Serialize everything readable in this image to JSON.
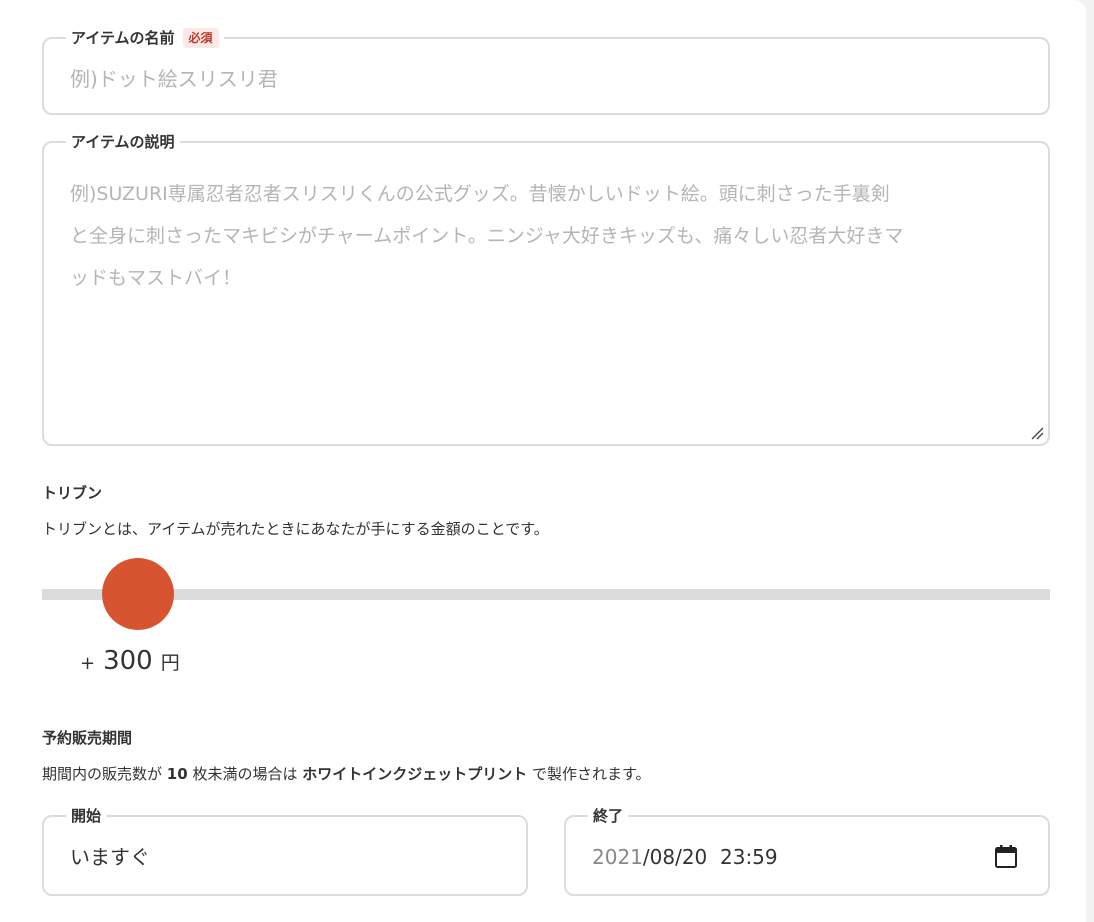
{
  "item_name": {
    "label": "アイテムの名前",
    "required_badge": "必須",
    "placeholder": "例)ドット絵スリスリ君"
  },
  "item_description": {
    "label": "アイテムの説明",
    "placeholder": "例)SUZURI専属忍者忍者スリスリくんの公式グッズ。昔懐かしいドット絵。頭に刺さった手裏剣\nと全身に刺さったマキビシがチャームポイント。ニンジャ大好きキッズも、痛々しい忍者大好きマ\nッドもマストバイ！"
  },
  "triben": {
    "title": "トリブン",
    "description": "トリブンとは、アイテムが売れたときにあなたが手にする金額のことです。",
    "plus": "+",
    "amount": "300",
    "unit": "円",
    "slider_fraction": 0.06
  },
  "presale": {
    "title": "予約販売期間",
    "desc_prefix": "期間内の販売数が",
    "desc_count": "10",
    "desc_mid": "枚未満の場合は",
    "desc_method": "ホワイトインクジェットプリント",
    "desc_suffix": "で製作されます。",
    "start": {
      "label": "開始",
      "value": "いますぐ"
    },
    "end": {
      "label": "終了",
      "date": "2021",
      "rest": "/08/20  23:59"
    }
  },
  "colors": {
    "accent": "#d6542f",
    "required": "#c0392b"
  }
}
